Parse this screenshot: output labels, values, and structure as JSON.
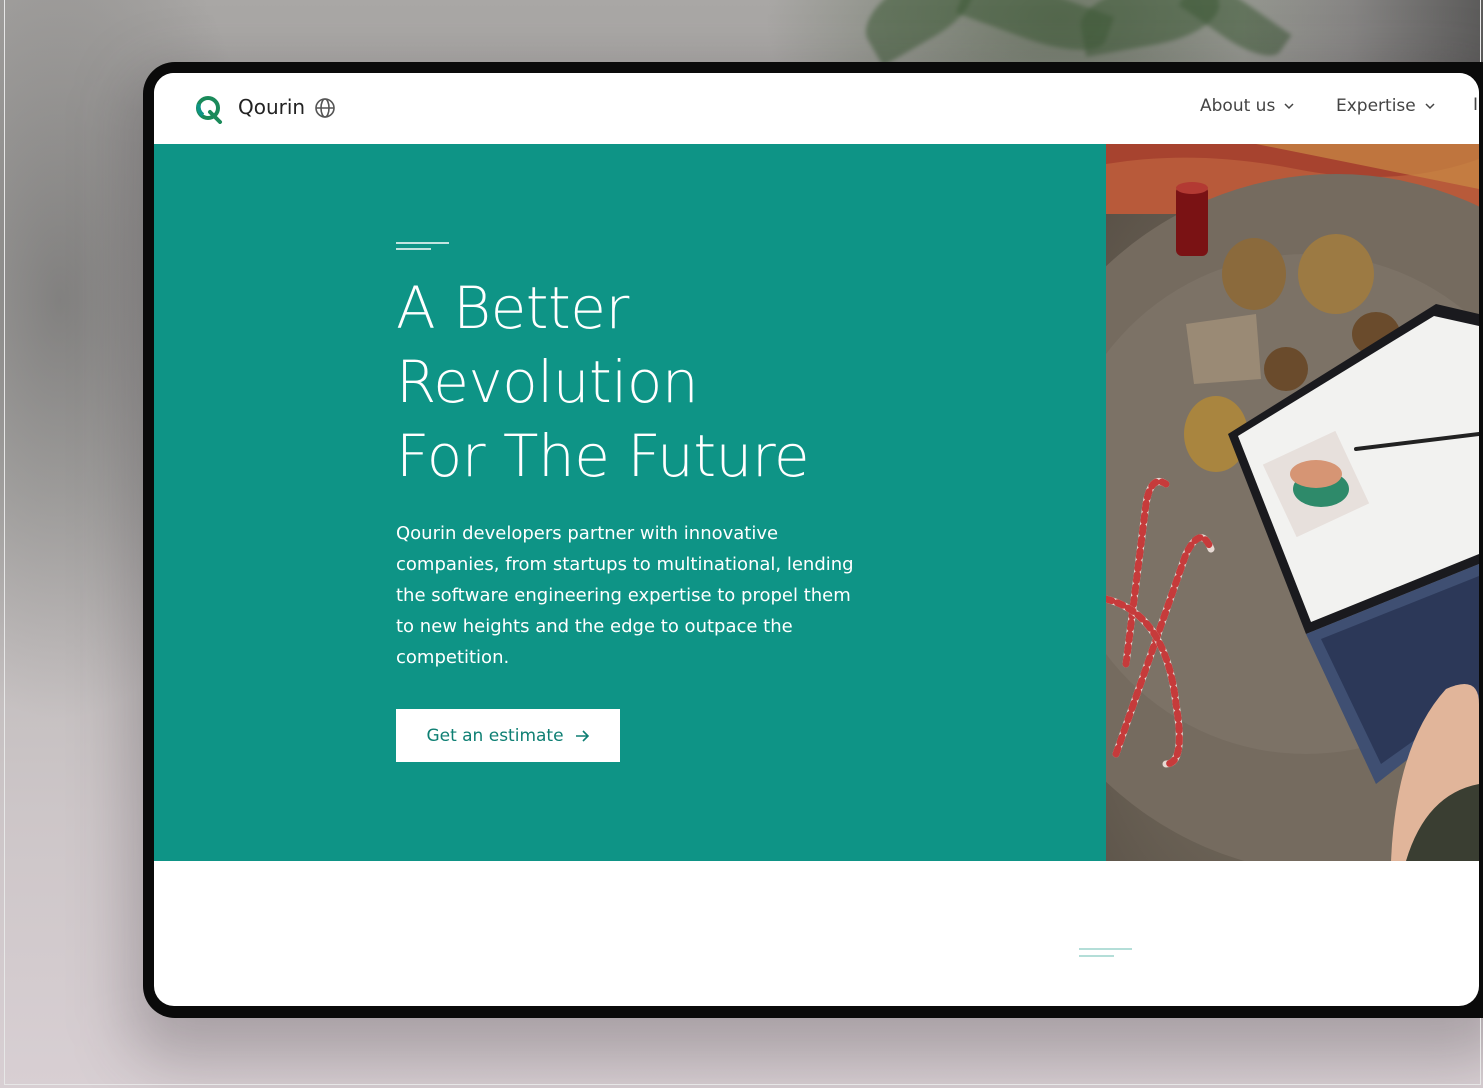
{
  "nav": {
    "brand": "Qourin",
    "items": [
      {
        "label": "About us"
      },
      {
        "label": "Expertise"
      }
    ],
    "cut_item": "I"
  },
  "hero": {
    "title_lines": [
      "A Better",
      "Revolution",
      "For The Future"
    ],
    "description": "Qourin developers partner with innovative companies, from startups to multinational, lending the software engineering expertise to propel them to new heights and the edge to outpace the competition.",
    "cta_label": "Get an estimate"
  },
  "colors": {
    "brand_teal": "#0e9486",
    "logo_green": "#1a8a5a",
    "white": "#ffffff"
  },
  "icons": {
    "logo": "q-logo-icon",
    "globe": "globe-icon",
    "chevron": "chevron-down-icon",
    "arrow": "arrow-right-icon"
  }
}
